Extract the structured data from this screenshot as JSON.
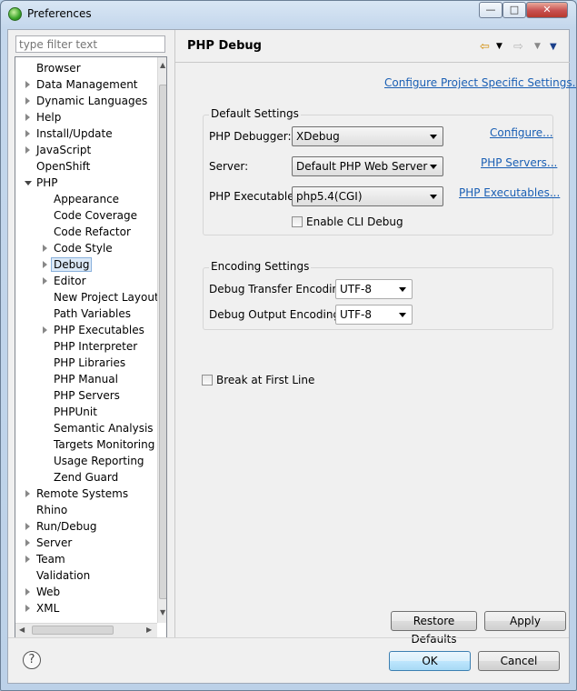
{
  "window": {
    "title": "Preferences"
  },
  "filter": {
    "placeholder": "type filter text"
  },
  "tree": {
    "items": [
      {
        "label": "Browser",
        "indent": 0,
        "arrow": "none"
      },
      {
        "label": "Data Management",
        "indent": 0,
        "arrow": "right"
      },
      {
        "label": "Dynamic Languages",
        "indent": 0,
        "arrow": "right"
      },
      {
        "label": "Help",
        "indent": 0,
        "arrow": "right"
      },
      {
        "label": "Install/Update",
        "indent": 0,
        "arrow": "right"
      },
      {
        "label": "JavaScript",
        "indent": 0,
        "arrow": "right"
      },
      {
        "label": "OpenShift",
        "indent": 0,
        "arrow": "none"
      },
      {
        "label": "PHP",
        "indent": 0,
        "arrow": "down"
      },
      {
        "label": "Appearance",
        "indent": 1,
        "arrow": "none"
      },
      {
        "label": "Code Coverage",
        "indent": 1,
        "arrow": "none"
      },
      {
        "label": "Code Refactor",
        "indent": 1,
        "arrow": "none"
      },
      {
        "label": "Code Style",
        "indent": 1,
        "arrow": "right"
      },
      {
        "label": "Debug",
        "indent": 1,
        "arrow": "right",
        "selected": true
      },
      {
        "label": "Editor",
        "indent": 1,
        "arrow": "right"
      },
      {
        "label": "New Project Layout",
        "indent": 1,
        "arrow": "none"
      },
      {
        "label": "Path Variables",
        "indent": 1,
        "arrow": "none"
      },
      {
        "label": "PHP Executables",
        "indent": 1,
        "arrow": "right"
      },
      {
        "label": "PHP Interpreter",
        "indent": 1,
        "arrow": "none"
      },
      {
        "label": "PHP Libraries",
        "indent": 1,
        "arrow": "none"
      },
      {
        "label": "PHP Manual",
        "indent": 1,
        "arrow": "none"
      },
      {
        "label": "PHP Servers",
        "indent": 1,
        "arrow": "none"
      },
      {
        "label": "PHPUnit",
        "indent": 1,
        "arrow": "none"
      },
      {
        "label": "Semantic Analysis P",
        "indent": 1,
        "arrow": "none"
      },
      {
        "label": "Targets Monitoring",
        "indent": 1,
        "arrow": "none"
      },
      {
        "label": "Usage Reporting",
        "indent": 1,
        "arrow": "none"
      },
      {
        "label": "Zend Guard",
        "indent": 1,
        "arrow": "none"
      },
      {
        "label": "Remote Systems",
        "indent": 0,
        "arrow": "right"
      },
      {
        "label": "Rhino",
        "indent": 0,
        "arrow": "none"
      },
      {
        "label": "Run/Debug",
        "indent": 0,
        "arrow": "right"
      },
      {
        "label": "Server",
        "indent": 0,
        "arrow": "right"
      },
      {
        "label": "Team",
        "indent": 0,
        "arrow": "right"
      },
      {
        "label": "Validation",
        "indent": 0,
        "arrow": "none"
      },
      {
        "label": "Web",
        "indent": 0,
        "arrow": "right"
      },
      {
        "label": "XML",
        "indent": 0,
        "arrow": "right"
      }
    ]
  },
  "page": {
    "title": "PHP Debug",
    "configure_project_link": "Configure Project Specific Settings...",
    "default_settings": {
      "title": "Default Settings",
      "debugger_label": "PHP Debugger:",
      "debugger_value": "XDebug",
      "debugger_link": "Configure...",
      "server_label": "Server:",
      "server_value": "Default PHP Web Server",
      "server_link": "PHP Servers...",
      "executable_label": "PHP Executable:",
      "executable_value": "php5.4(CGI)",
      "executable_link": "PHP Executables...",
      "cli_debug_label": "Enable CLI Debug"
    },
    "encoding_settings": {
      "title": "Encoding Settings",
      "transfer_label": "Debug Transfer Encoding",
      "transfer_value": "UTF-8",
      "output_label": "Debug Output Encoding",
      "output_value": "UTF-8"
    },
    "break_first_line_label": "Break at First Line",
    "restore_defaults": "Restore Defaults",
    "apply": "Apply"
  },
  "footer": {
    "ok": "OK",
    "cancel": "Cancel",
    "help": "?"
  },
  "icons": {
    "back": "back-arrow-icon",
    "forward": "forward-arrow-icon",
    "menu": "view-menu-icon"
  }
}
